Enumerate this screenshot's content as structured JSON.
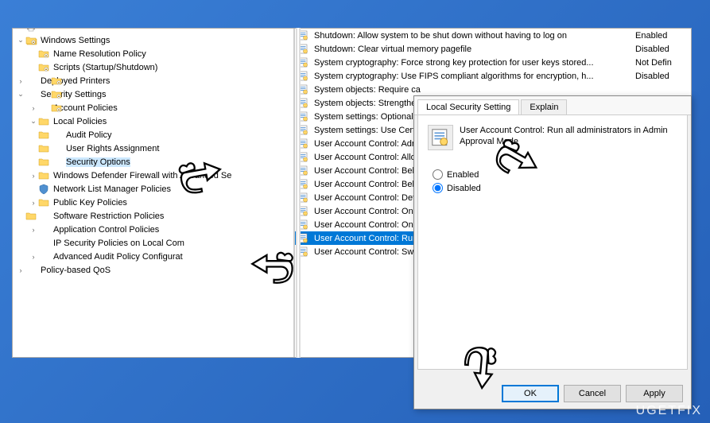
{
  "watermark": "UGETFIX",
  "tree": {
    "windows_settings": "Windows Settings",
    "name_resolution": "Name Resolution Policy",
    "scripts": "Scripts (Startup/Shutdown)",
    "deployed_printers": "Deployed Printers",
    "security_settings": "Security Settings",
    "account_policies": "Account Policies",
    "local_policies": "Local Policies",
    "audit_policy": "Audit Policy",
    "user_rights": "User Rights Assignment",
    "security_options": "Security Options",
    "defender_firewall": "Windows Defender Firewall with Advanced Se",
    "network_list": "Network List Manager Policies",
    "public_key": "Public Key Policies",
    "software_restriction": "Software Restriction Policies",
    "application_control": "Application Control Policies",
    "ip_security": "IP Security Policies on Local Com",
    "advanced_audit": "Advanced Audit Policy Configurat",
    "policy_based": "Policy-based QoS"
  },
  "policies": [
    {
      "name": "Shutdown: Allow system to be shut down without having to log on",
      "state": "Enabled"
    },
    {
      "name": "Shutdown: Clear virtual memory pagefile",
      "state": "Disabled"
    },
    {
      "name": "System cryptography: Force strong key protection for user keys stored...",
      "state": "Not Defin"
    },
    {
      "name": "System cryptography: Use FIPS compliant algorithms for encryption, h...",
      "state": "Disabled"
    },
    {
      "name": "System objects: Require ca",
      "state": ""
    },
    {
      "name": "System objects: Strengthen",
      "state": ""
    },
    {
      "name": "System settings: Optional s",
      "state": ""
    },
    {
      "name": "System settings: Use Certif",
      "state": ""
    },
    {
      "name": "User Account Control: Adr",
      "state": ""
    },
    {
      "name": "User Account Control: Allo",
      "state": ""
    },
    {
      "name": "User Account Control: Beh",
      "state": ""
    },
    {
      "name": "User Account Control: Beh",
      "state": ""
    },
    {
      "name": "User Account Control: Det",
      "state": ""
    },
    {
      "name": "User Account Control: Onl",
      "state": ""
    },
    {
      "name": "User Account Control: Onl",
      "state": ""
    },
    {
      "name": "User Account Control: Run",
      "state": "",
      "selected": true
    },
    {
      "name": "User Account Control: Swit",
      "state": ""
    }
  ],
  "dialog": {
    "tab_local": "Local Security Setting",
    "tab_explain": "Explain",
    "title": "User Account Control: Run all administrators in Admin Approval Mode",
    "enabled_label": "Enabled",
    "disabled_label": "Disabled",
    "ok": "OK",
    "cancel": "Cancel",
    "apply": "Apply"
  }
}
